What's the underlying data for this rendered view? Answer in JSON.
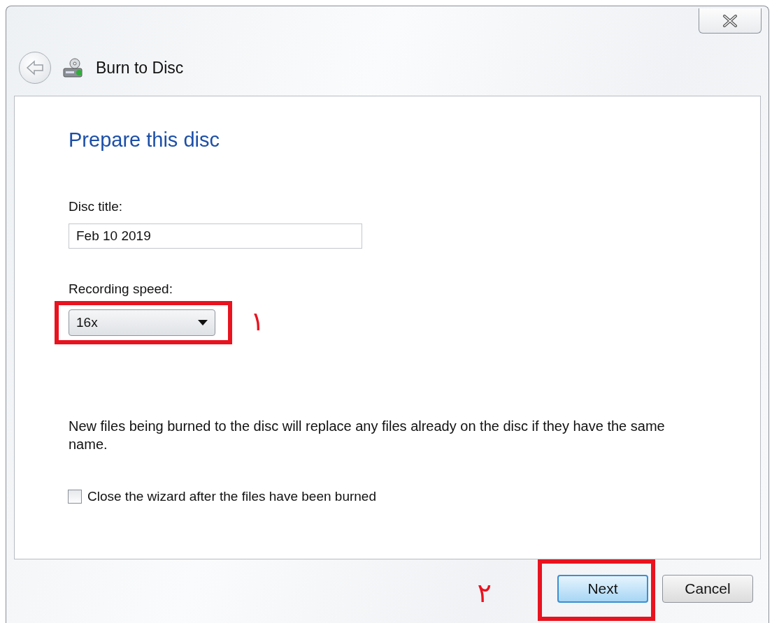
{
  "window": {
    "title": "Burn to Disc"
  },
  "heading": "Prepare this disc",
  "disc_title": {
    "label": "Disc title:",
    "value": "Feb 10 2019"
  },
  "recording_speed": {
    "label": "Recording speed:",
    "value": "16x"
  },
  "note": "New files being burned to the disc will replace any files already on the disc if they have the same name.",
  "close_wizard": {
    "label": "Close the wizard after the files have been burned",
    "checked": false
  },
  "buttons": [
    {
      "label": "Next",
      "kind": "default"
    },
    {
      "label": "Cancel",
      "kind": "normal"
    }
  ],
  "annotations": [
    {
      "number": "١"
    },
    {
      "number": "٢"
    }
  ]
}
